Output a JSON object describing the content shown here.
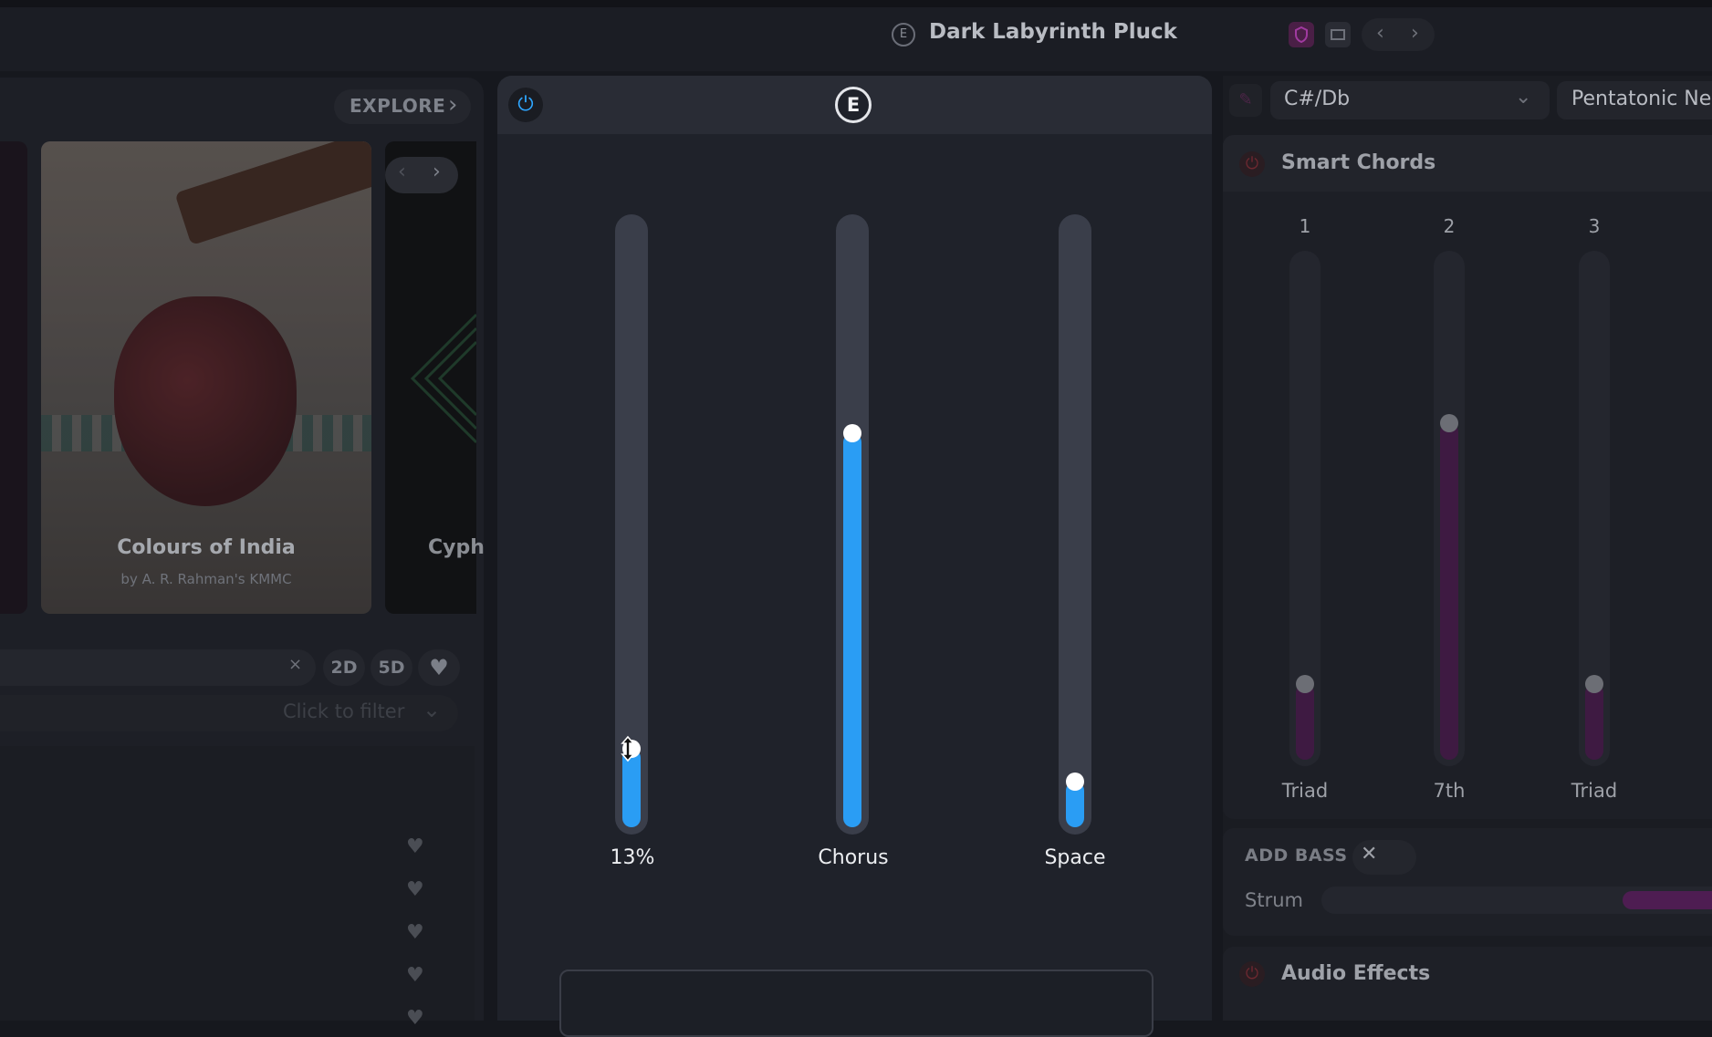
{
  "header": {
    "preset_badge": "E",
    "preset_name": "Dark Labyrinth Pluck",
    "icons": [
      "shield-icon",
      "preset-type-icon",
      "chevron-left-icon",
      "chevron-right-icon"
    ],
    "prev_glyph": "‹",
    "next_glyph": "›"
  },
  "browser": {
    "explore_label": "EXPLORE",
    "explore_glyph": "›",
    "cards": [
      {
        "title": "Colours of India",
        "subtitle": "by A. R. Rahman's KMMC"
      },
      {
        "title": "Cyph"
      }
    ],
    "card_nav_prev": "‹",
    "card_nav_next": "›",
    "search_clear": "×",
    "filter_pills": [
      "2D",
      "5D"
    ],
    "heart_glyph": "♥",
    "filter_placeholder": "Click to filter",
    "filter_chev": "⌄",
    "list_heart_count": 5
  },
  "macros": {
    "power_glyph": "⏻",
    "badge": "E",
    "sliders": [
      {
        "label": "13%",
        "value": 0.13,
        "active": true
      },
      {
        "label": "Chorus",
        "value": 0.65
      },
      {
        "label": "Space",
        "value": 0.075
      }
    ]
  },
  "key": {
    "pencil_glyph": "✎",
    "root": "C#/Db",
    "root_chev": "⌄",
    "scale": "Pentatonic Ne"
  },
  "smart_chords": {
    "power_glyph": "⏻",
    "title": "Smart Chords",
    "columns": [
      {
        "number": "1",
        "type": "Triad",
        "value": 0.15
      },
      {
        "number": "2",
        "type": "7th",
        "value": 0.67
      },
      {
        "number": "3",
        "type": "Triad",
        "value": 0.15
      }
    ]
  },
  "bass": {
    "label": "ADD BASS",
    "close_glyph": "✕",
    "strum_label": "Strum",
    "strum_value": 0.23
  },
  "audio_effects": {
    "power_glyph": "⏻",
    "title": "Audio Effects"
  },
  "colors": {
    "accent_blue": "#2a9df4",
    "accent_purple": "#3e1a42",
    "panel_bg": "#1f222a"
  }
}
